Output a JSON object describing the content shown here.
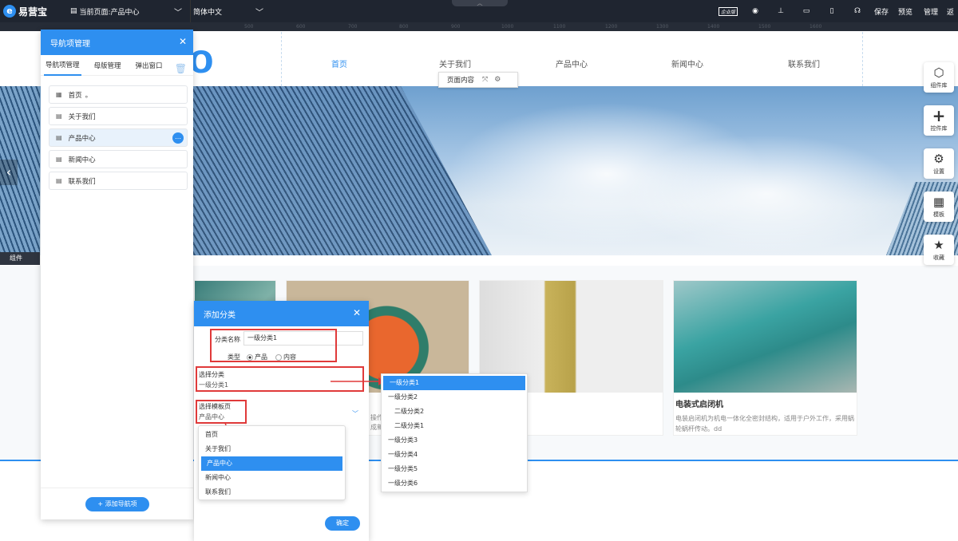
{
  "topbar": {
    "logo_mark": "e",
    "logo_text": "易营宝",
    "page_selector": "当前页面:产品中心",
    "language": "简体中文",
    "tools": {
      "enterprise": "企业版",
      "save": "保存",
      "preview": "预览",
      "manage": "管理",
      "return": "返"
    }
  },
  "ruler": {
    "ticks": [
      "500",
      "600",
      "700",
      "800",
      "900",
      "1000",
      "1100",
      "1200",
      "1300",
      "1400",
      "1500",
      "1600"
    ]
  },
  "site": {
    "logo_partial": "o",
    "nav": [
      "首页",
      "关于我们",
      "产品中心",
      "新闻中心",
      "联系我们"
    ],
    "page_content_chip": "页面内容",
    "components_label": "组件",
    "product": {
      "title": "电装式启闭机",
      "desc": "电装启闭机为机电一体化全密封结构，适用于户外工作，采用蜗轮蜗杆传动。dd"
    },
    "partial_text": "操作",
    "partial_text2": "成新"
  },
  "right_rail": [
    {
      "icon": "cube-icon",
      "label": "组件库"
    },
    {
      "icon": "plus-icon",
      "label": "控件库"
    },
    {
      "icon": "gear-icon",
      "label": "设置"
    },
    {
      "icon": "grid-icon",
      "label": "模板"
    },
    {
      "icon": "star-icon",
      "label": "收藏"
    }
  ],
  "nav_panel": {
    "title": "导航项管理",
    "tabs": [
      "导航项管理",
      "母版管理",
      "弹出窗口"
    ],
    "items": [
      {
        "label": "首页",
        "suffix": "。"
      },
      {
        "label": "关于我们"
      },
      {
        "label": "产品中心"
      },
      {
        "label": "新闻中心"
      },
      {
        "label": "联系我们"
      }
    ],
    "add_button": "+ 添加导航项"
  },
  "add_category": {
    "title": "添加分类",
    "name_label": "分类名称",
    "name_value": "一级分类1",
    "type_label": "类型",
    "type_options": [
      "产品",
      "内容"
    ],
    "select_category_label": "选择分类",
    "select_category_value": "一级分类1",
    "select_template_label": "选择模板页",
    "select_template_value": "产品中心",
    "confirm": "确定"
  },
  "category_dropdown": [
    "一级分类1",
    "一级分类2",
    "二级分类2",
    "二级分类1",
    "一级分类3",
    "一级分类4",
    "一级分类5",
    "一级分类6"
  ],
  "template_dropdown": [
    "首页",
    "关于我们",
    "产品中心",
    "新闻中心",
    "联系我们"
  ],
  "colors": {
    "accent": "#2e8ff0",
    "topbar": "#1f2530",
    "highlight_red": "#e03a3a"
  }
}
